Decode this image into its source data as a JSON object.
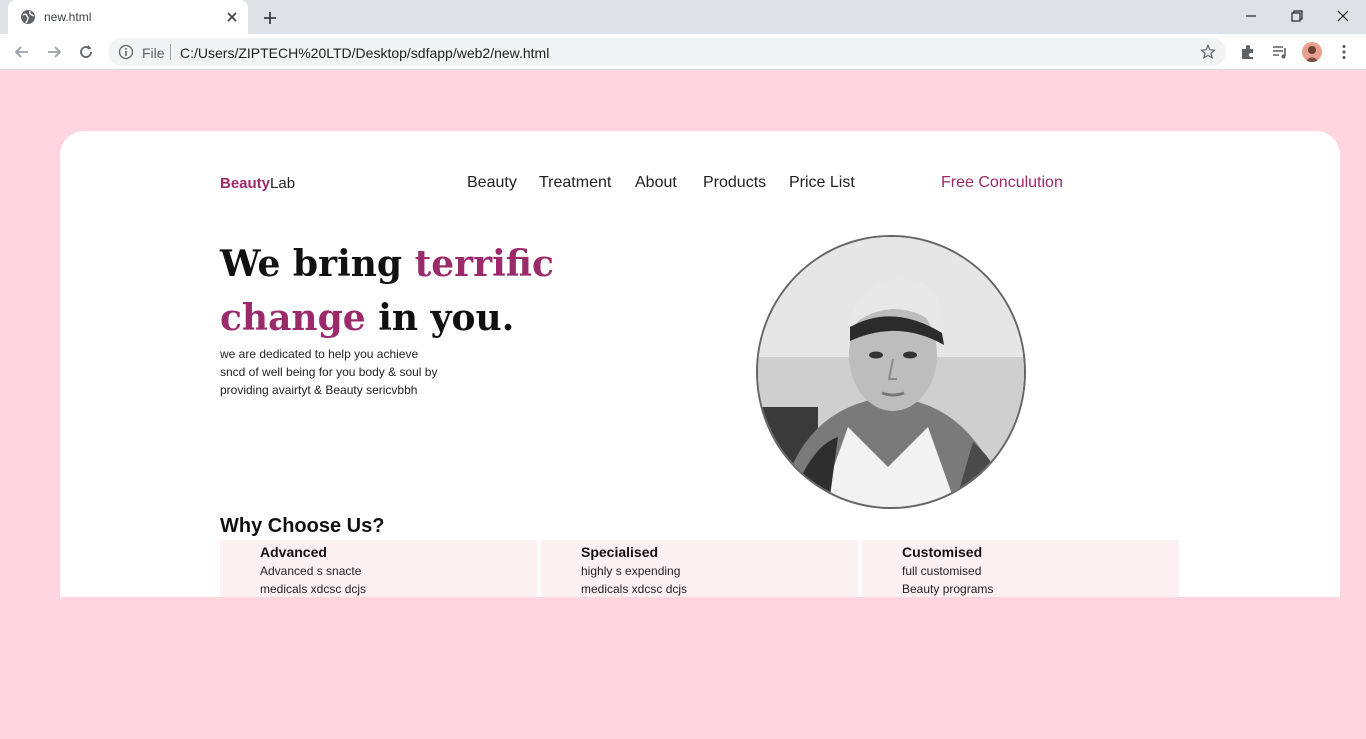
{
  "browser": {
    "tab_title": "new.html",
    "omnibox_scheme": "File",
    "url": "C:/Users/ZIPTECH%20LTD/Desktop/sdfapp/web2/new.html"
  },
  "page": {
    "logo_bold": "Beauty",
    "logo_rest": "Lab",
    "nav": [
      "Beauty",
      "Treatment",
      "About",
      "Products",
      "Price List"
    ],
    "cta": "Free Conculution",
    "hero": {
      "line1_plain": "We bring ",
      "line1_highlight": "terrific",
      "line2_highlight": "change",
      "line2_plain": " in you.",
      "desc_lines": [
        "we are dedicated to help you achieve",
        "sncd of well being for you body & soul by",
        "providing avairtyt & Beauty sericvbbh"
      ]
    },
    "why_title": "Why Choose Us?",
    "features": [
      {
        "title": "Advanced",
        "lines": [
          "Advanced s snacte",
          "medicals xdcsc dcjs"
        ]
      },
      {
        "title": "Specialised",
        "lines": [
          "highly s expending",
          "medicals xdcsc dcjs"
        ]
      },
      {
        "title": "Customised",
        "lines": [
          "full customised",
          "Beauty programs"
        ]
      }
    ]
  },
  "colors": {
    "page_background": "#ffd6e0",
    "brand_accent": "#9b2a6b",
    "feature_background": "#fdf0f2"
  },
  "icons": [
    "globe-icon",
    "close-icon",
    "plus-icon",
    "minimize-icon",
    "restore-icon",
    "back-icon",
    "forward-icon",
    "reload-icon",
    "info-icon",
    "star-icon",
    "extensions-icon",
    "media-queue-icon",
    "menu-icon"
  ]
}
